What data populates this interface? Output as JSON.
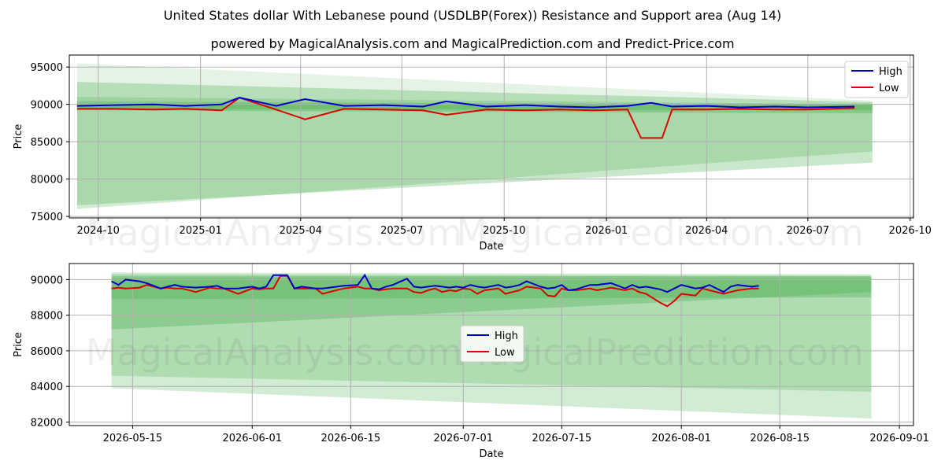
{
  "title": "United States dollar With Lebanese pound (USDLBP(Forex)) Resistance and Support area (Aug 14)",
  "subtitle": "powered by MagicalAnalysis.com and MagicalPrediction.com and Predict-Price.com",
  "watermarks": [
    "MagicalAnalysis.com",
    "MagicalPrediction.com"
  ],
  "colors": {
    "high": "#0000cc",
    "low": "#dd0000",
    "band": "#4caf50"
  },
  "chart_data": [
    {
      "type": "line",
      "xlabel": "Date",
      "ylabel": "Price",
      "x_range": [
        "2024-09-05",
        "2026-10-04"
      ],
      "ylim": [
        74800,
        96600
      ],
      "x_ticks": [
        "2024-10",
        "2025-01",
        "2025-04",
        "2025-07",
        "2025-10",
        "2026-01",
        "2026-04",
        "2026-07",
        "2026-10"
      ],
      "x_tick_dates": [
        "2024-10-01",
        "2025-01-01",
        "2025-04-01",
        "2025-07-01",
        "2025-10-01",
        "2026-01-01",
        "2026-04-01",
        "2026-07-01",
        "2026-10-01"
      ],
      "y_ticks": [
        75000,
        80000,
        85000,
        90000,
        95000
      ],
      "legend": {
        "position": "top-right",
        "entries": [
          "High",
          "Low"
        ]
      },
      "grid": true,
      "series": [
        {
          "name": "High",
          "dates": [
            "2024-09-12",
            "2024-10-15",
            "2024-11-20",
            "2024-12-18",
            "2025-01-20",
            "2025-02-05",
            "2025-03-10",
            "2025-04-05",
            "2025-05-10",
            "2025-06-15",
            "2025-07-20",
            "2025-08-10",
            "2025-09-15",
            "2025-10-20",
            "2025-11-20",
            "2025-12-20",
            "2026-01-20",
            "2026-02-10",
            "2026-03-01",
            "2026-04-01",
            "2026-05-01",
            "2026-06-01",
            "2026-07-01",
            "2026-08-12"
          ],
          "values": [
            89800,
            89900,
            90000,
            89800,
            90000,
            90900,
            89800,
            90700,
            89800,
            89900,
            89700,
            90400,
            89700,
            89900,
            89700,
            89600,
            89800,
            90200,
            89700,
            89800,
            89600,
            89700,
            89600,
            89700
          ]
        },
        {
          "name": "Low",
          "dates": [
            "2024-09-12",
            "2024-10-15",
            "2024-11-20",
            "2024-12-18",
            "2025-01-20",
            "2025-02-05",
            "2025-03-10",
            "2025-04-05",
            "2025-05-10",
            "2025-06-15",
            "2025-07-20",
            "2025-08-10",
            "2025-09-15",
            "2025-10-20",
            "2025-11-20",
            "2025-12-20",
            "2026-01-20",
            "2026-02-01",
            "2026-02-10",
            "2026-02-20",
            "2026-03-01",
            "2026-04-01",
            "2026-05-01",
            "2026-06-01",
            "2026-07-01",
            "2026-08-12"
          ],
          "values": [
            89400,
            89400,
            89300,
            89400,
            89200,
            90900,
            89300,
            88000,
            89400,
            89300,
            89200,
            88600,
            89300,
            89200,
            89300,
            89200,
            89300,
            85500,
            85500,
            85500,
            89300,
            89300,
            89400,
            89300,
            89300,
            89500
          ]
        }
      ],
      "bands": [
        {
          "start_date": "2024-09-12",
          "end_date": "2026-08-28",
          "top": [
            95500,
            90500
          ],
          "bottom": [
            90200,
            89800
          ],
          "opacity": 0.15
        },
        {
          "start_date": "2024-09-12",
          "end_date": "2026-08-28",
          "top": [
            93000,
            90300
          ],
          "bottom": [
            76500,
            82200
          ],
          "opacity": 0.3
        },
        {
          "start_date": "2024-09-12",
          "end_date": "2026-08-28",
          "top": [
            91000,
            90000
          ],
          "bottom": [
            76000,
            83700
          ],
          "opacity": 0.25
        },
        {
          "start_date": "2024-09-12",
          "end_date": "2026-08-28",
          "top": [
            90400,
            89900
          ],
          "bottom": [
            89200,
            88800
          ],
          "opacity": 0.35
        },
        {
          "start_date": "2024-09-12",
          "end_date": "2026-08-28",
          "top": [
            90100,
            90100
          ],
          "bottom": [
            89400,
            89200
          ],
          "opacity": 0.4
        }
      ]
    },
    {
      "type": "line",
      "xlabel": "Date",
      "ylabel": "Price",
      "x_range": [
        "2026-05-06",
        "2026-09-03"
      ],
      "ylim": [
        81800,
        90900
      ],
      "x_ticks": [
        "2026-05-15",
        "2026-06-01",
        "2026-06-15",
        "2026-07-01",
        "2026-07-15",
        "2026-08-01",
        "2026-08-15",
        "2026-09-01"
      ],
      "y_ticks": [
        82000,
        84000,
        86000,
        88000,
        90000
      ],
      "legend": {
        "position": "center",
        "entries": [
          "High",
          "Low"
        ]
      },
      "grid": true,
      "series": [
        {
          "name": "High",
          "dates": [
            "2026-05-12",
            "2026-05-13",
            "2026-05-14",
            "2026-05-16",
            "2026-05-17",
            "2026-05-19",
            "2026-05-20",
            "2026-05-21",
            "2026-05-22",
            "2026-05-24",
            "2026-05-26",
            "2026-05-27",
            "2026-05-28",
            "2026-05-30",
            "2026-06-01",
            "2026-06-02",
            "2026-06-03",
            "2026-06-04",
            "2026-06-05",
            "2026-06-06",
            "2026-06-07",
            "2026-06-08",
            "2026-06-10",
            "2026-06-11",
            "2026-06-12",
            "2026-06-14",
            "2026-06-16",
            "2026-06-17",
            "2026-06-18",
            "2026-06-19",
            "2026-06-20",
            "2026-06-21",
            "2026-06-23",
            "2026-06-24",
            "2026-06-25",
            "2026-06-26",
            "2026-06-27",
            "2026-06-28",
            "2026-06-29",
            "2026-06-30",
            "2026-07-01",
            "2026-07-02",
            "2026-07-03",
            "2026-07-04",
            "2026-07-06",
            "2026-07-07",
            "2026-07-08",
            "2026-07-09",
            "2026-07-10",
            "2026-07-12",
            "2026-07-13",
            "2026-07-14",
            "2026-07-15",
            "2026-07-16",
            "2026-07-17",
            "2026-07-19",
            "2026-07-20",
            "2026-07-22",
            "2026-07-24",
            "2026-07-25",
            "2026-07-26",
            "2026-07-27",
            "2026-07-29",
            "2026-07-30",
            "2026-07-31",
            "2026-08-01",
            "2026-08-03",
            "2026-08-04",
            "2026-08-05",
            "2026-08-07",
            "2026-08-08",
            "2026-08-09",
            "2026-08-11",
            "2026-08-12"
          ],
          "values": [
            89900,
            89700,
            90000,
            89900,
            89800,
            89500,
            89600,
            89700,
            89600,
            89550,
            89600,
            89650,
            89500,
            89500,
            89600,
            89500,
            89600,
            90250,
            90250,
            90250,
            89500,
            89600,
            89500,
            89500,
            89550,
            89650,
            89700,
            90250,
            89500,
            89450,
            89600,
            89700,
            90050,
            89600,
            89550,
            89600,
            89650,
            89600,
            89550,
            89600,
            89550,
            89700,
            89600,
            89550,
            89700,
            89550,
            89600,
            89700,
            89900,
            89600,
            89500,
            89550,
            89700,
            89400,
            89450,
            89700,
            89700,
            89800,
            89500,
            89700,
            89550,
            89600,
            89450,
            89300,
            89500,
            89700,
            89500,
            89550,
            89700,
            89300,
            89600,
            89700,
            89600,
            89650
          ]
        },
        {
          "name": "Low",
          "dates": [
            "2026-05-12",
            "2026-05-13",
            "2026-05-14",
            "2026-05-16",
            "2026-05-17",
            "2026-05-19",
            "2026-05-20",
            "2026-05-21",
            "2026-05-22",
            "2026-05-24",
            "2026-05-26",
            "2026-05-27",
            "2026-05-28",
            "2026-05-30",
            "2026-06-01",
            "2026-06-02",
            "2026-06-03",
            "2026-06-04",
            "2026-06-05",
            "2026-06-06",
            "2026-06-07",
            "2026-06-08",
            "2026-06-10",
            "2026-06-11",
            "2026-06-12",
            "2026-06-14",
            "2026-06-16",
            "2026-06-17",
            "2026-06-18",
            "2026-06-19",
            "2026-06-20",
            "2026-06-21",
            "2026-06-23",
            "2026-06-24",
            "2026-06-25",
            "2026-06-26",
            "2026-06-27",
            "2026-06-28",
            "2026-06-29",
            "2026-06-30",
            "2026-07-01",
            "2026-07-02",
            "2026-07-03",
            "2026-07-04",
            "2026-07-06",
            "2026-07-07",
            "2026-07-08",
            "2026-07-09",
            "2026-07-10",
            "2026-07-12",
            "2026-07-13",
            "2026-07-14",
            "2026-07-15",
            "2026-07-16",
            "2026-07-17",
            "2026-07-19",
            "2026-07-20",
            "2026-07-22",
            "2026-07-24",
            "2026-07-25",
            "2026-07-26",
            "2026-07-27",
            "2026-07-29",
            "2026-07-30",
            "2026-07-31",
            "2026-08-01",
            "2026-08-03",
            "2026-08-04",
            "2026-08-05",
            "2026-08-07",
            "2026-08-08",
            "2026-08-09",
            "2026-08-11",
            "2026-08-12"
          ],
          "values": [
            89500,
            89550,
            89500,
            89550,
            89700,
            89500,
            89550,
            89500,
            89500,
            89300,
            89550,
            89500,
            89500,
            89200,
            89500,
            89450,
            89500,
            89500,
            90200,
            90200,
            89500,
            89500,
            89500,
            89200,
            89300,
            89500,
            89600,
            89500,
            89500,
            89400,
            89450,
            89500,
            89500,
            89300,
            89250,
            89400,
            89500,
            89300,
            89400,
            89350,
            89500,
            89450,
            89200,
            89400,
            89500,
            89200,
            89300,
            89400,
            89600,
            89500,
            89100,
            89050,
            89500,
            89400,
            89400,
            89500,
            89400,
            89550,
            89400,
            89500,
            89300,
            89200,
            88700,
            88500,
            88800,
            89200,
            89100,
            89500,
            89400,
            89200,
            89300,
            89400,
            89500,
            89500
          ]
        }
      ],
      "bands": [
        {
          "start_date": "2026-05-12",
          "end_date": "2026-08-28",
          "top": [
            90400,
            90300
          ],
          "bottom": [
            83900,
            82200
          ],
          "opacity": 0.25
        },
        {
          "start_date": "2026-05-12",
          "end_date": "2026-08-28",
          "top": [
            90300,
            90200
          ],
          "bottom": [
            84600,
            83700
          ],
          "opacity": 0.25
        },
        {
          "start_date": "2026-05-12",
          "end_date": "2026-08-28",
          "top": [
            90200,
            90200
          ],
          "bottom": [
            87200,
            89300
          ],
          "opacity": 0.35
        },
        {
          "start_date": "2026-05-12",
          "end_date": "2026-08-28",
          "top": [
            90100,
            90100
          ],
          "bottom": [
            88900,
            89000
          ],
          "opacity": 0.35
        }
      ]
    }
  ]
}
